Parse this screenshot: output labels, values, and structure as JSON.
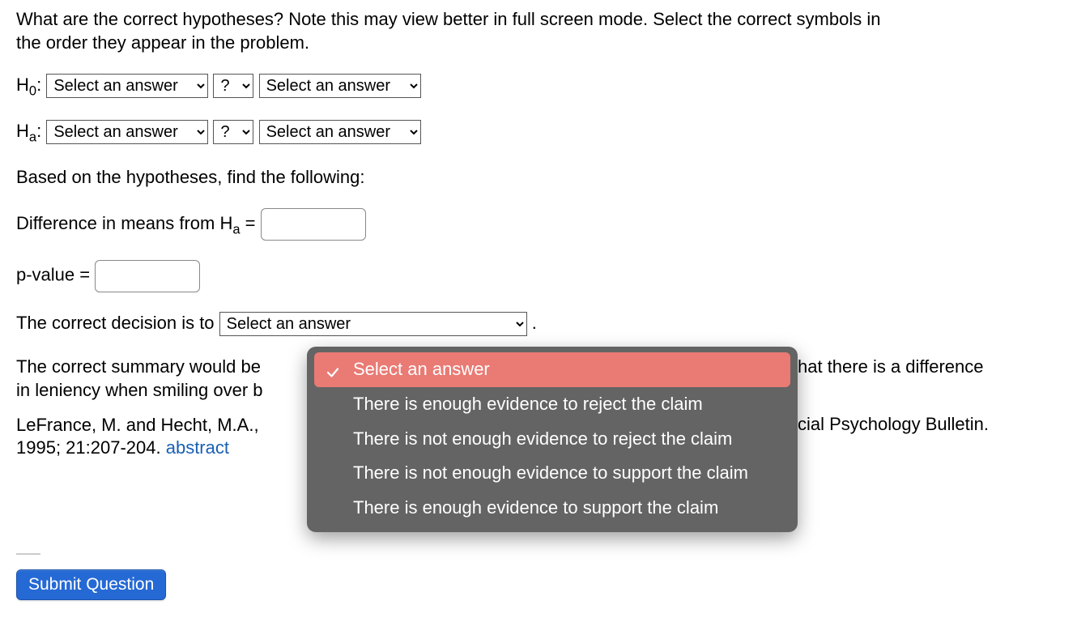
{
  "prompt": "What are the correct hypotheses? Note this may view better in full screen mode. Select the correct symbols in the order they appear in the problem.",
  "h0_label": "H",
  "h0_sub": "0",
  "ha_label": "H",
  "ha_sub": "a",
  "select_placeholder": "Select an answer",
  "q_placeholder": "?",
  "based_on_text": "Based on the hypotheses, find the following:",
  "diff_text_pre": "Difference in means from H",
  "diff_text_sub": "a",
  "diff_text_post": " = ",
  "pvalue_text": "p-value = ",
  "decision_text_pre": "The correct decision is to ",
  "decision_text_post": " .",
  "summary_line1_a": "The correct summary would be",
  "summary_line1_b": "hat there is a difference",
  "summary_line2": "in leniency when smiling over b",
  "citation_a": "LeFrance, M. and Hecht, M.A.,",
  "citation_b": "cial Psychology Bulletin.",
  "citation_line2": "1995; 21:207-204. ",
  "abstract_link": "abstract",
  "submit_label": "Submit Question",
  "dropdown": {
    "options": [
      "Select an answer",
      "There is enough evidence to reject the claim",
      "There is not enough evidence to reject the claim",
      "There is not enough evidence to support the claim",
      "There is enough evidence to support the claim"
    ],
    "selected_index": 0
  }
}
